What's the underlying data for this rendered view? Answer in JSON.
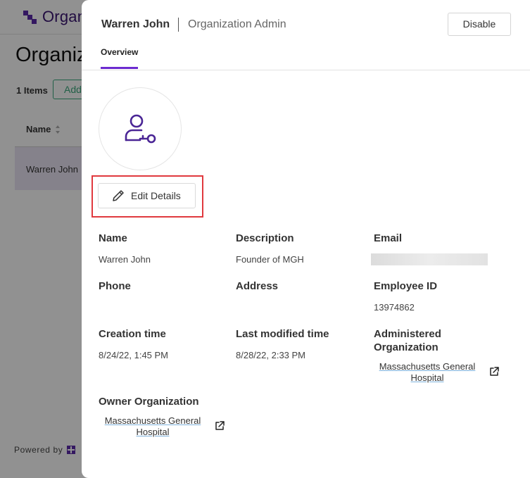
{
  "background": {
    "logo_text": "Organ",
    "page_title": "Organiz",
    "items_count": "1 Items",
    "add_button": "Add",
    "name_column": "Name",
    "row_name": "Warren John",
    "powered_by": "Powered by"
  },
  "drawer": {
    "user_name": "Warren John",
    "role": "Organization Admin",
    "disable_button": "Disable",
    "tab_overview": "Overview",
    "edit_details_button": "Edit Details",
    "accent_color": "#6c2bd0",
    "highlight_color": "#e0393e"
  },
  "fields": {
    "name_label": "Name",
    "name_value": "Warren John",
    "description_label": "Description",
    "description_value": "Founder of MGH",
    "email_label": "Email",
    "phone_label": "Phone",
    "address_label": "Address",
    "employee_id_label": "Employee ID",
    "employee_id_value": "13974862",
    "creation_time_label": "Creation time",
    "creation_time_value": "8/24/22, 1:45 PM",
    "last_modified_label": "Last modified time",
    "last_modified_value": "8/28/22, 2:33 PM",
    "administered_org_label_1": "Administered",
    "administered_org_label_2": "Organization",
    "administered_org_value_1": "Massachusetts General",
    "administered_org_value_2": "Hospital",
    "owner_org_label": "Owner Organization",
    "owner_org_value_1": "Massachusetts General",
    "owner_org_value_2": "Hospital"
  },
  "icons": {
    "avatar": "user-key-icon",
    "edit": "pencil-icon",
    "external": "external-link-icon",
    "sort": "sort-icon"
  }
}
